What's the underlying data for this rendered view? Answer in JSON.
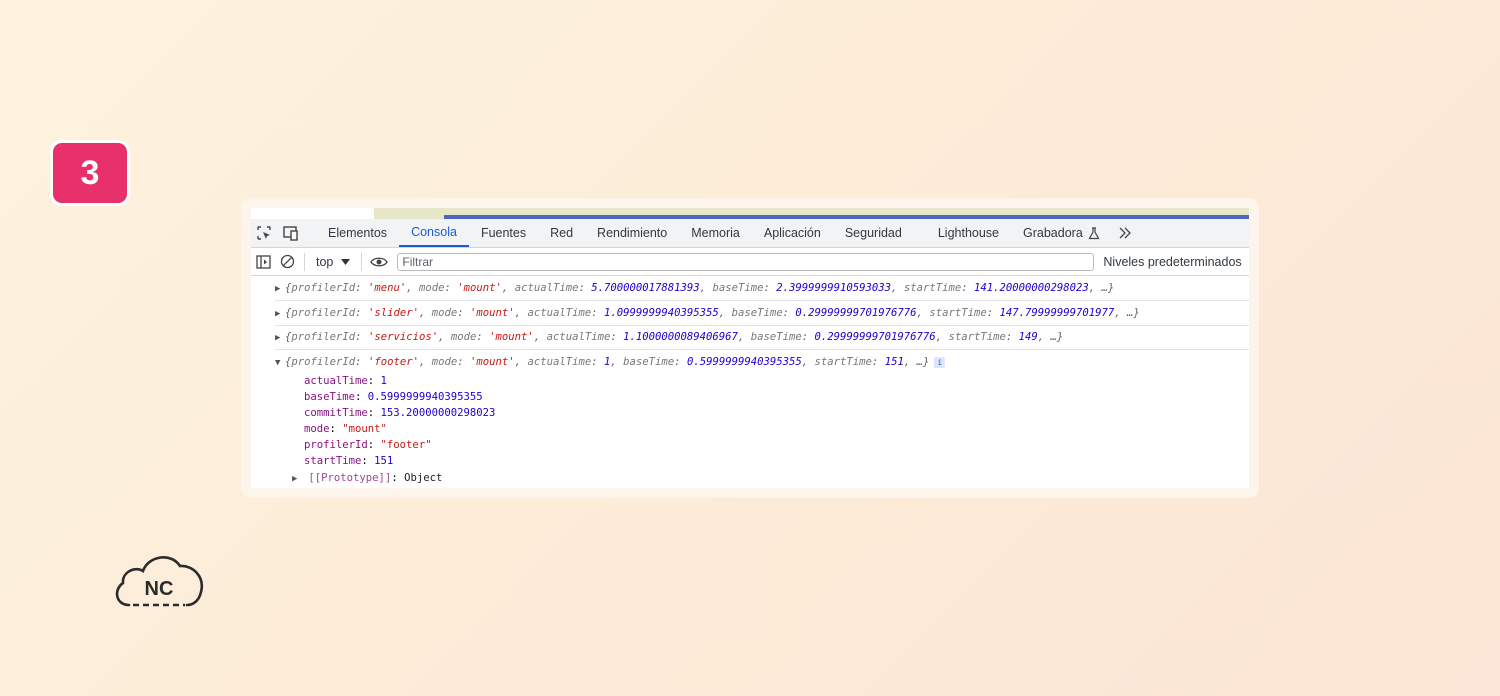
{
  "step_badge": "3",
  "devtools": {
    "tabs": [
      "Elementos",
      "Consola",
      "Fuentes",
      "Red",
      "Rendimiento",
      "Memoria",
      "Aplicación",
      "Seguridad",
      "Lighthouse",
      "Grabadora"
    ],
    "active_tab": "Consola",
    "toolbar": {
      "context": "top",
      "filter_placeholder": "Filtrar",
      "levels_label": "Niveles predeterminados"
    },
    "logs": [
      {
        "profilerId": "'menu'",
        "mode": "'mount'",
        "actualTime": "5.700000017881393",
        "baseTime": "2.3999999910593033",
        "startTime": "141.20000000298023"
      },
      {
        "profilerId": "'slider'",
        "mode": "'mount'",
        "actualTime": "1.0999999940395355",
        "baseTime": "0.29999999701976776",
        "startTime": "147.79999999701977"
      },
      {
        "profilerId": "'servicios'",
        "mode": "'mount'",
        "actualTime": "1.1000000089406967",
        "baseTime": "0.29999999701976776",
        "startTime": "149"
      },
      {
        "profilerId": "'footer'",
        "mode": "'mount'",
        "actualTime": "1",
        "baseTime": "0.5999999940395355",
        "startTime": "151"
      }
    ],
    "expanded": {
      "props": [
        {
          "key": "actualTime",
          "value": "1",
          "kind": "num"
        },
        {
          "key": "baseTime",
          "value": "0.5999999940395355",
          "kind": "num"
        },
        {
          "key": "commitTime",
          "value": "153.20000000298023",
          "kind": "num"
        },
        {
          "key": "mode",
          "value": "\"mount\"",
          "kind": "str"
        },
        {
          "key": "profilerId",
          "value": "\"footer\"",
          "kind": "str"
        },
        {
          "key": "startTime",
          "value": "151",
          "kind": "num"
        }
      ],
      "prototype_key": "[[Prototype]]",
      "prototype_value": "Object"
    }
  },
  "logo_text": "NC"
}
